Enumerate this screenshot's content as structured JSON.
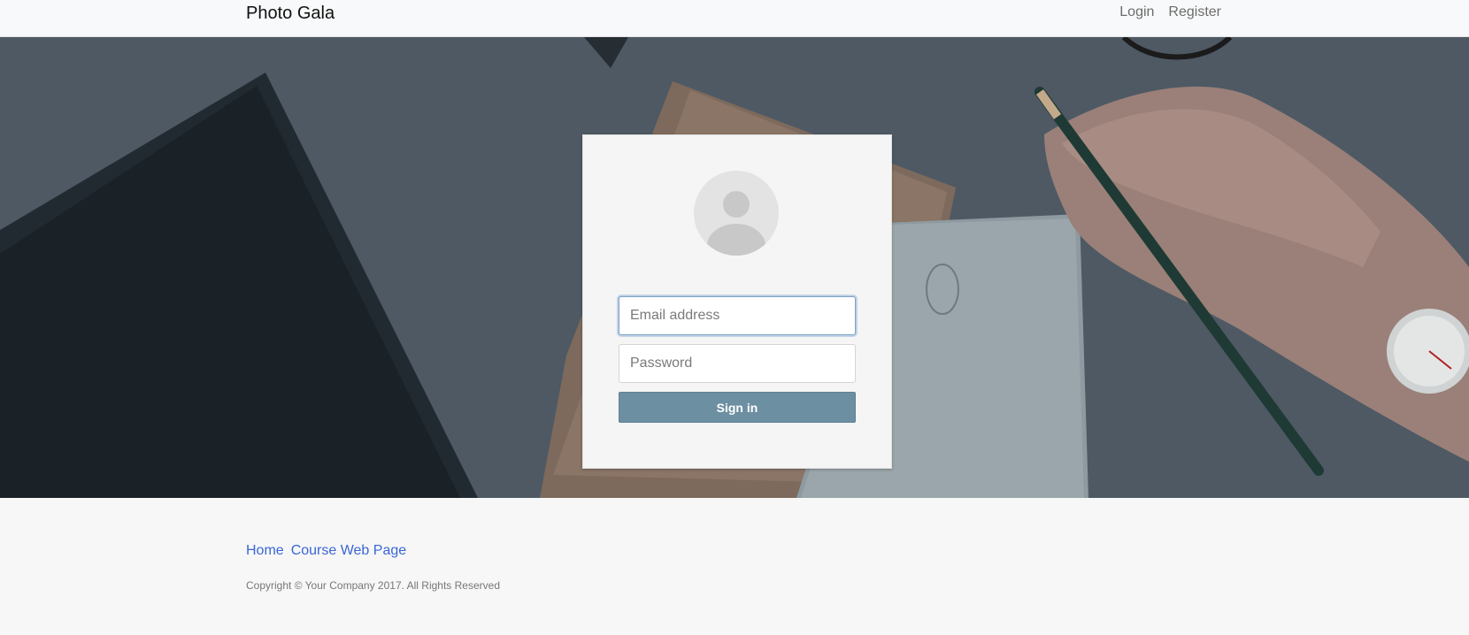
{
  "navbar": {
    "brand": "Photo Gala",
    "links": [
      "Login",
      "Register"
    ]
  },
  "login": {
    "email_placeholder": "Email address",
    "password_placeholder": "Password",
    "submit_label": "Sign in"
  },
  "footer": {
    "links": [
      "Home",
      "Course Web Page"
    ],
    "copyright": "Copyright © Your Company 2017. All Rights Reserved"
  },
  "colors": {
    "accent": "#6c8fa1",
    "link": "#3a66d6"
  }
}
